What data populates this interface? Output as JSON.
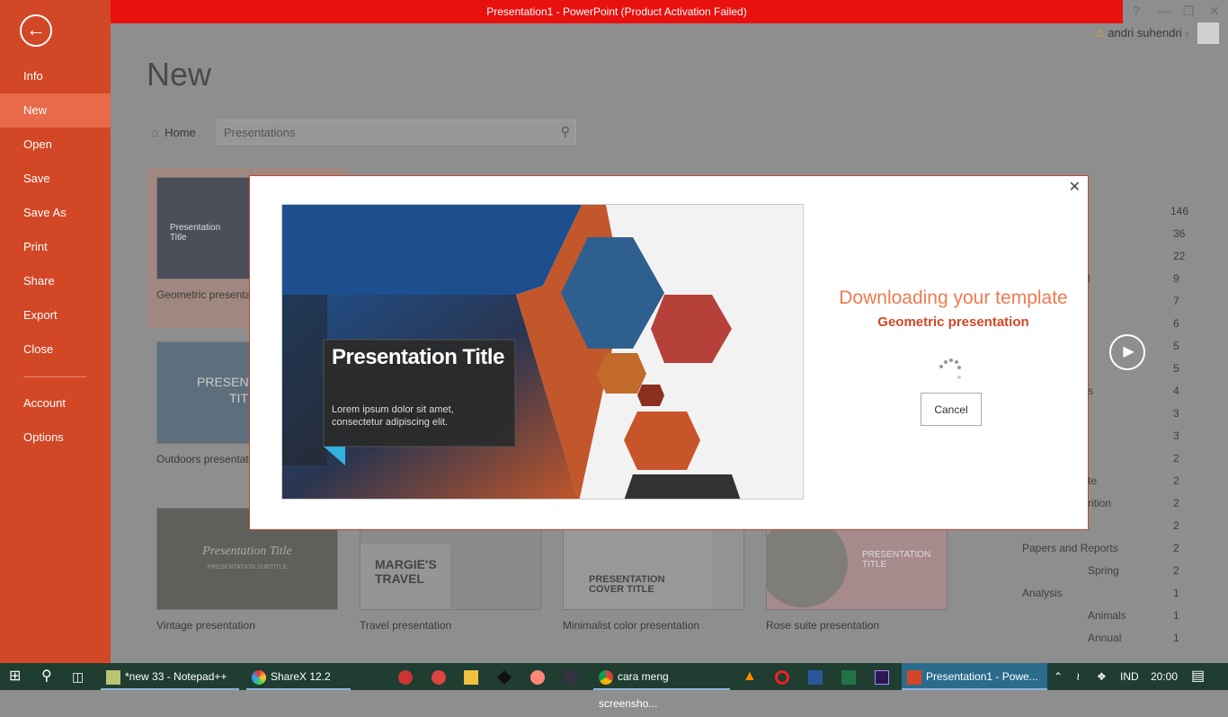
{
  "window": {
    "title": "Presentation1 -  PowerPoint (Product Activation Failed)",
    "user": "andri suhendri",
    "controls": [
      "?",
      "—",
      "❐",
      "✕"
    ]
  },
  "sidebar": {
    "items": [
      {
        "label": "Info"
      },
      {
        "label": "New",
        "active": true
      },
      {
        "label": "Open"
      },
      {
        "label": "Save"
      },
      {
        "label": "Save As"
      },
      {
        "label": "Print"
      },
      {
        "label": "Share"
      },
      {
        "label": "Export"
      },
      {
        "label": "Close"
      },
      {
        "label": "Account"
      },
      {
        "label": "Options"
      }
    ],
    "accent": "#d24726"
  },
  "main": {
    "title": "New",
    "home": "Home",
    "search_placeholder": "Presentations",
    "templates": [
      {
        "label": "Geometric presentation",
        "visible": "Geometric presenta"
      },
      {
        "label": "Outdoors presentation",
        "visible": "Outdoors presentat"
      },
      {
        "label": "Vintage presentation"
      },
      {
        "label": "Travel presentation"
      },
      {
        "label": "Minimalist color presentation"
      },
      {
        "label": "Rose suite presentation"
      }
    ],
    "thumb_text": {
      "geo_title": "Presentation Title",
      "outdoors": "PRESENT",
      "outdoors2": "TIT",
      "vintage": "Presentation Title",
      "vintage_sub": "PRESENTATION SUBTITLE",
      "travel": "MARGIE'S TRAVEL",
      "minimal": "PRESENTATION COVER TITLE",
      "rose": "PRESENTATION TITLE"
    },
    "categories": [
      {
        "label": "",
        "count": "146"
      },
      {
        "label": "",
        "count": "36"
      },
      {
        "label": "",
        "count": "22"
      },
      {
        "label": "l",
        "count": "9"
      },
      {
        "label": "",
        "count": "7"
      },
      {
        "label": "",
        "count": "6"
      },
      {
        "label": "",
        "count": "5"
      },
      {
        "label": "",
        "count": "5"
      },
      {
        "label": "s",
        "count": "4"
      },
      {
        "label": "",
        "count": "3"
      },
      {
        "label": "",
        "count": "3"
      },
      {
        "label": "",
        "count": "2"
      },
      {
        "label": "te",
        "count": "2"
      },
      {
        "label": "rition",
        "count": "2"
      },
      {
        "label": "",
        "count": "2"
      },
      {
        "label": "Papers and Reports",
        "count": "2"
      },
      {
        "label": "Spring",
        "count": "2"
      },
      {
        "label": "Analysis",
        "count": "1"
      },
      {
        "label": "Animals",
        "count": "1"
      },
      {
        "label": "Annual",
        "count": "1"
      }
    ]
  },
  "dialog": {
    "heading": "Downloading your template",
    "template_name": "Geometric presentation",
    "cancel": "Cancel",
    "preview": {
      "title": "Presentation Title",
      "body": "Lorem ipsum dolor sit amet, consectetur adipiscing elit."
    }
  },
  "taskbar": {
    "items": [
      {
        "label": "*new 33 - Notepad++"
      },
      {
        "label": "ShareX 12.2"
      },
      {
        "label": "cara meng screensho..."
      },
      {
        "label": "Presentation1 - Powe..."
      }
    ],
    "lang": "IND",
    "time": "20:00"
  }
}
